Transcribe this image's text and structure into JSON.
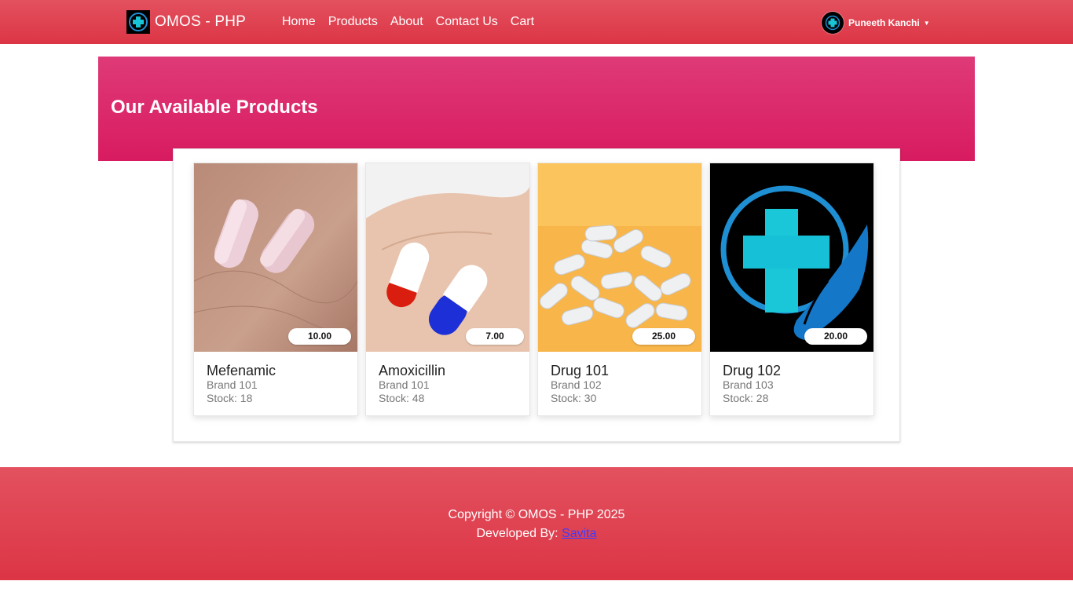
{
  "navbar": {
    "brand": "OMOS - PHP",
    "links": [
      "Home",
      "Products",
      "About",
      "Contact Us",
      "Cart"
    ],
    "user_name": "Puneeth Kanchi"
  },
  "hero": {
    "title": "Our Available Products"
  },
  "products": [
    {
      "name": "Mefenamic",
      "brand": "Brand 101",
      "stock": "Stock: 18",
      "price": "10.00"
    },
    {
      "name": "Amoxicillin",
      "brand": "Brand 101",
      "stock": "Stock: 48",
      "price": "7.00"
    },
    {
      "name": "Drug 101",
      "brand": "Brand 102",
      "stock": "Stock: 30",
      "price": "25.00"
    },
    {
      "name": "Drug 102",
      "brand": "Brand 103",
      "stock": "Stock: 28",
      "price": "20.00"
    }
  ],
  "footer": {
    "copyright": "Copyright © OMOS - PHP 2025",
    "developed_prefix": "Developed By:",
    "developer": "Savita"
  },
  "colors": {
    "navbar": "#dc3545",
    "hero": "#d81b60",
    "footer": "#dc3545"
  },
  "icons": {
    "brand_logo": "medical-cross-icon",
    "avatar": "medical-cross-icon",
    "caret": "caret-down-icon"
  }
}
